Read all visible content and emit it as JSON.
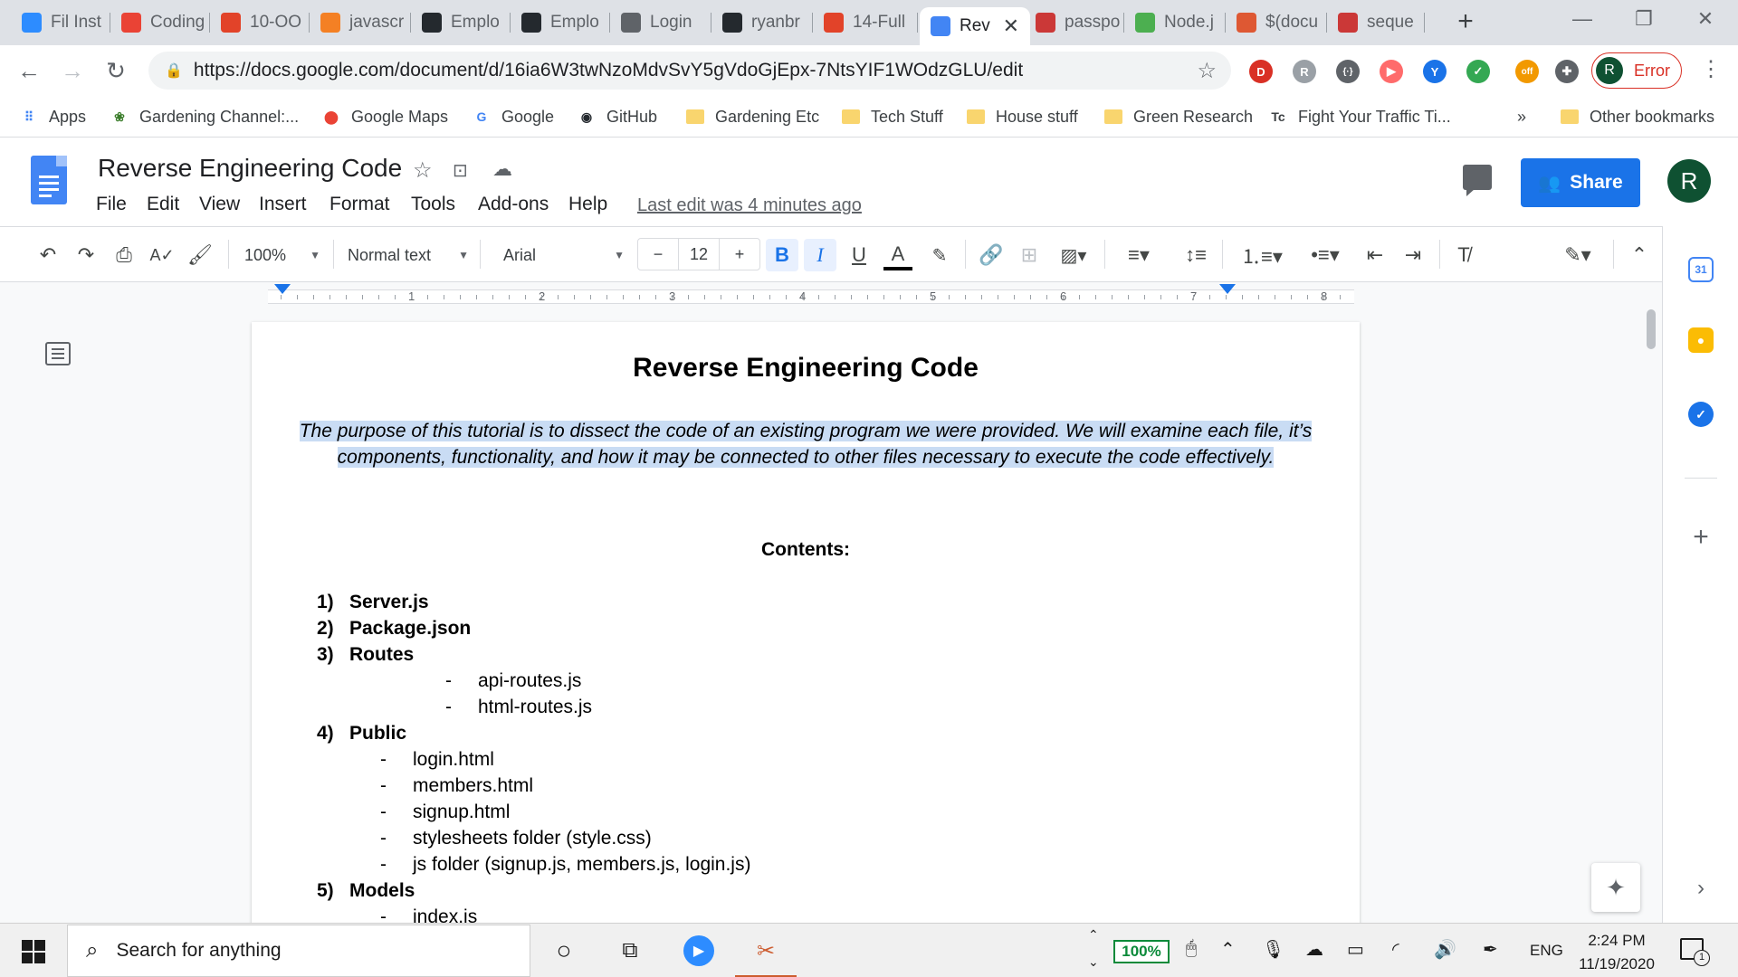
{
  "browser": {
    "tabs": [
      {
        "label": "Fil Inst",
        "favicon": "zoom-icon",
        "color": "#2d8cff"
      },
      {
        "label": "Coding",
        "favicon": "gmail-icon",
        "color": "#ea4335"
      },
      {
        "label": "10-OO",
        "favicon": "gitlab-icon",
        "color": "#e24329"
      },
      {
        "label": "javascr",
        "favicon": "stackoverflow-icon",
        "color": "#f48024"
      },
      {
        "label": "Emplo",
        "favicon": "github-icon",
        "color": "#24292e"
      },
      {
        "label": "Emplo",
        "favicon": "github-icon",
        "color": "#24292e"
      },
      {
        "label": "Login",
        "favicon": "globe-icon",
        "color": "#5f6368"
      },
      {
        "label": "ryanbr",
        "favicon": "github-icon",
        "color": "#24292e"
      },
      {
        "label": "14-Full",
        "favicon": "gitlab-icon",
        "color": "#e24329"
      },
      {
        "label": "Rev",
        "favicon": "docs-icon",
        "color": "#4285f4",
        "active": true
      },
      {
        "label": "passpo",
        "favicon": "npm-icon",
        "color": "#cb3837"
      },
      {
        "label": "Node.j",
        "favicon": "w3schools-icon",
        "color": "#4caf50"
      },
      {
        "label": "$(docu",
        "favicon": "duckduckgo-icon",
        "color": "#de5833"
      },
      {
        "label": "seque",
        "favicon": "npm-icon",
        "color": "#cb3837"
      }
    ],
    "url": "https://docs.google.com/document/d/16ia6W3twNzoMdvSvY5gVdoGjEpx-7NtsYIF1WOdzGLU/edit",
    "profile": {
      "initial": "R",
      "status": "Error"
    },
    "extensions": [
      {
        "name": "dashlane-icon",
        "glyph": "D",
        "color": "#d93025"
      },
      {
        "name": "readwise-icon",
        "glyph": "R",
        "color": "#9aa0a6"
      },
      {
        "name": "devtools-icon",
        "glyph": "{·}",
        "color": "#5f6368"
      },
      {
        "name": "screencast-icon",
        "glyph": "▶",
        "color": "#ff6b6b"
      },
      {
        "name": "vpn-icon",
        "glyph": "Y",
        "color": "#1a73e8"
      },
      {
        "name": "shield-icon",
        "glyph": "✓",
        "color": "#34a853"
      },
      {
        "name": "off-extension-icon",
        "glyph": "off",
        "color": "#f29900"
      },
      {
        "name": "puzzle-icon",
        "glyph": "✚",
        "color": "#5f6368"
      }
    ],
    "bookmarks": [
      {
        "label": "Apps",
        "icon": "apps-grid-icon"
      },
      {
        "label": "Gardening Channel:...",
        "icon": "garden-icon"
      },
      {
        "label": "Google Maps",
        "icon": "maps-pin-icon"
      },
      {
        "label": "Google",
        "icon": "google-icon"
      },
      {
        "label": "GitHub",
        "icon": "github-icon"
      },
      {
        "label": "Gardening Etc",
        "icon": "folder-icon"
      },
      {
        "label": "Tech Stuff",
        "icon": "folder-icon"
      },
      {
        "label": "House stuff",
        "icon": "folder-icon"
      },
      {
        "label": "Green Research",
        "icon": "folder-icon"
      },
      {
        "label": "Fight Your Traffic Ti...",
        "icon": "tc-icon"
      }
    ],
    "bookmarks_more": "»",
    "other_bookmarks": "Other bookmarks"
  },
  "docs": {
    "title": "Reverse Engineering Code",
    "menu": [
      "File",
      "Edit",
      "View",
      "Insert",
      "Format",
      "Tools",
      "Add-ons",
      "Help"
    ],
    "last_edit": "Last edit was 4 minutes ago",
    "share_label": "Share",
    "user_initial": "R",
    "toolbar": {
      "zoom": "100%",
      "style": "Normal text",
      "font": "Arial",
      "font_size": "12",
      "minus": "−",
      "plus": "+"
    },
    "ruler_numbers": [
      "1",
      "2",
      "3",
      "4",
      "5",
      "6",
      "7",
      "8"
    ]
  },
  "document": {
    "heading": "Reverse Engineering Code",
    "intro": "The purpose of this tutorial is to dissect the code of an existing program we were provided. We will examine each file, it’s components, functionality, and how it may be connected to other files necessary to execute the code effectively.",
    "contents_heading": "Contents:",
    "items": [
      {
        "num": "1)",
        "text": "Server.js"
      },
      {
        "num": "2)",
        "text": "Package.json"
      },
      {
        "num": "3)",
        "text": "Routes"
      },
      {
        "num": "-",
        "text": "api-routes.js"
      },
      {
        "num": "-",
        "text": "html-routes.js"
      },
      {
        "num": "4)",
        "text": "Public"
      },
      {
        "num": "-",
        "text": "login.html"
      },
      {
        "num": "-",
        "text": "members.html"
      },
      {
        "num": "-",
        "text": "signup.html"
      },
      {
        "num": "-",
        "text": "stylesheets folder (style.css)"
      },
      {
        "num": "-",
        "text": "js folder (signup.js, members.js, login.js)"
      },
      {
        "num": "5)",
        "text": "Models"
      },
      {
        "num": "-",
        "text": "index.js"
      }
    ]
  },
  "taskbar": {
    "search_placeholder": "Search for anything",
    "zoom": "100%",
    "language": "ENG",
    "time": "2:24 PM",
    "date": "11/19/2020",
    "notifications": "1"
  }
}
